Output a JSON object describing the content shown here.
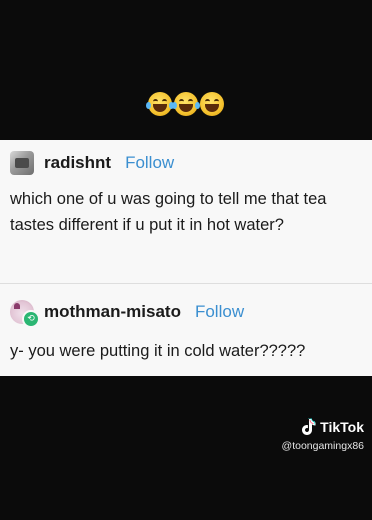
{
  "emojis": [
    {
      "name": "face-with-tears-of-joy-icon"
    },
    {
      "name": "face-with-tears-of-joy-icon"
    },
    {
      "name": "grinning-face-icon"
    }
  ],
  "posts": [
    {
      "username": "radishnt",
      "follow_label": "Follow",
      "text": "which one of u was going to tell me that tea tastes different if u put it in hot water?"
    },
    {
      "username": "mothman-misato",
      "follow_label": "Follow",
      "text": "y- you were putting it in cold water?????"
    }
  ],
  "watermark": {
    "brand": "TikTok",
    "handle": "@toongamingx86"
  },
  "colors": {
    "follow": "#3b8fd0",
    "card_bg": "#f8f8f8",
    "page_bg": "#0b0b0b"
  }
}
